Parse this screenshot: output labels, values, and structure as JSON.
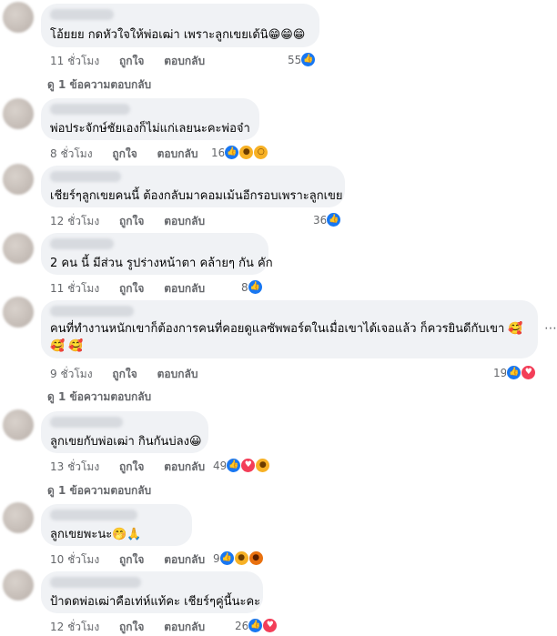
{
  "comments": [
    {
      "text": "โอ้ยยย กดหัวใจให้พ่อเฒ่า เพราะลูกเขยเด้นิ😁😁😁",
      "time": "11 ชั่วโมง",
      "like": "ถูกใจ",
      "reply": "ตอบกลับ",
      "count": "55",
      "reactions": [
        "like-icon"
      ],
      "replies": "ดู 1 ข้อความตอบกลับ"
    },
    {
      "text": "พ่อประจักษ์ชัยเองก็ไม่แก่เลยนะคะพ่อจ๋า",
      "time": "8 ชั่วโมง",
      "like": "ถูกใจ",
      "reply": "ตอบกลับ",
      "count": "16",
      "reactions": [
        "like-icon",
        "haha-icon",
        "wow-icon"
      ]
    },
    {
      "text": "เชียร์ๆลูกเขยคนนี้ ต้องกลับมาคอมเม้นอีกรอบเพราะลูกเขย",
      "time": "12 ชั่วโมง",
      "like": "ถูกใจ",
      "reply": "ตอบกลับ",
      "count": "36",
      "reactions": [
        "like-icon"
      ]
    },
    {
      "text": "2 คน นี้ มีส่วน รูปร่างหน้าตา คล้ายๆ กัน คัก",
      "time": "11 ชั่วโมง",
      "like": "ถูกใจ",
      "reply": "ตอบกลับ",
      "count": "8",
      "reactions": [
        "like-icon"
      ]
    },
    {
      "text": "คนที่ทำงานหนักเขาก็ต้องการคนที่คอยดูแลซัพพอร์ตในเมื่อเขาได้เจอแล้ว ก็ควรยินดีกับเขา 🥰🥰 🥰",
      "time": "9 ชั่วโมง",
      "like": "ถูกใจ",
      "reply": "ตอบกลับ",
      "count": "19",
      "reactions": [
        "like-icon",
        "love-icon"
      ],
      "replies": "ดู 1 ข้อความตอบกลับ"
    },
    {
      "text": "ลูกเขยกับพ่อเฒ่า กินกันบ่ลง😀",
      "time": "13 ชั่วโมง",
      "like": "ถูกใจ",
      "reply": "ตอบกลับ",
      "count": "49",
      "reactions": [
        "like-icon",
        "love-icon",
        "haha-icon"
      ],
      "replies": "ดู 1 ข้อความตอบกลับ"
    },
    {
      "text": "ลูกเขยพะนะ🤭🙏",
      "time": "10 ชั่วโมง",
      "like": "ถูกใจ",
      "reply": "ตอบกลับ",
      "count": "9",
      "reactions": [
        "like-icon",
        "haha-icon",
        "angry-icon"
      ]
    },
    {
      "text": "ป้าดดพ่อเฒ่าคือเท่ห์แท้คะ เชียร์ๆคู่นี้นะคะ",
      "time": "12 ชั่วโมง",
      "like": "ถูกใจ",
      "reply": "ตอบกลับ",
      "count": "26",
      "reactions": [
        "like-icon",
        "love-icon"
      ]
    }
  ],
  "more_icon": "more-options-icon",
  "colors": {
    "bubble": "#f0f2f5",
    "meta": "#65676b",
    "like": "#1877f2",
    "love": "#f33e58",
    "haha": "#f7b125"
  }
}
